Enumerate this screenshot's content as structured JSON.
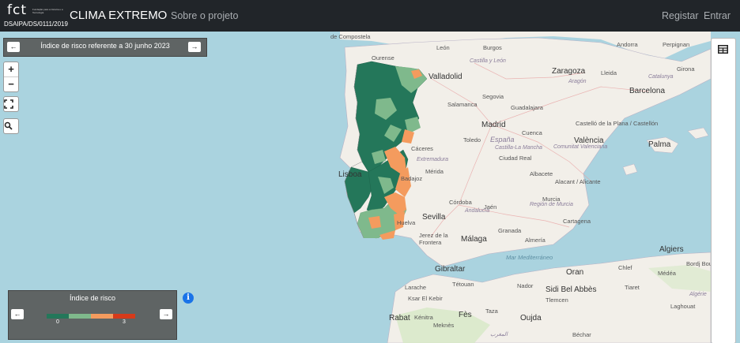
{
  "header": {
    "logo_text": "fct",
    "logo_tagline": "Fundação para a Ciência e a Tecnologia",
    "logo_code": "DSAIPA/DS/0111/2019",
    "brand": "CLIMA EXTREMO",
    "nav_about": "Sobre o projeto",
    "nav_register": "Registar",
    "nav_login": "Entrar"
  },
  "date_control": {
    "label": "Índice de risco referente a 30 junho 2023",
    "prev_icon": "←",
    "next_icon": "→"
  },
  "zoom": {
    "in": "+",
    "out": "−"
  },
  "legend": {
    "title": "Índice de risco",
    "min_label": "0",
    "max_label": "3",
    "prev_icon": "←",
    "next_icon": "→",
    "colors": [
      "#24775a",
      "#7fb98c",
      "#f49b5e",
      "#d63a1a"
    ]
  },
  "info": {
    "symbol": "i"
  },
  "map_labels": {
    "compostela": "de Compostela",
    "ourense": "Ourense",
    "leon": "León",
    "burgos": "Burgos",
    "castilla_leon": "Castilla y León",
    "valladolid": "Valladolid",
    "zaragoza": "Zaragoza",
    "aragon": "Aragón",
    "andorra": "Andorra",
    "perpignan": "Perpignan",
    "lleida": "Lleida",
    "girona": "Girona",
    "barcelona": "Barcelona",
    "catalunya": "Catalunya",
    "salamanca": "Salamanca",
    "segovia": "Segovia",
    "guadalajara": "Guadalajara",
    "madrid": "Madrid",
    "castellon": "Castelló de la Plana / Castellón",
    "toledo": "Toledo",
    "espana": "España",
    "cuenca": "Cuenca",
    "caceres": "Cáceres",
    "valencia": "València",
    "comunitat_valenciana": "Comunitat Valenciana",
    "palma": "Palma",
    "castilla_la_mancha": "Castilla-La Mancha",
    "extremadura": "Extremadura",
    "ciudad_real": "Ciudad Real",
    "merida": "Mérida",
    "albacete": "Albacete",
    "alacant": "Alacant / Alicante",
    "badajoz": "Badajoz",
    "cordoba": "Córdoba",
    "jaen": "Jaén",
    "murcia": "Murcia",
    "lisboa": "Lisboa",
    "region_murcia": "Región de Murcia",
    "sevilla": "Sevilla",
    "andalucia": "Andalucía",
    "granada": "Granada",
    "cartagena": "Cartagena",
    "huelva": "Huelva",
    "jerez": "Jerez de la Frontera",
    "malaga": "Málaga",
    "almeria": "Almería",
    "gibraltar": "Gibraltar",
    "algiers": "Algiers",
    "bordj": "Bordj Bou",
    "chlef": "Chlef",
    "medea": "Médéa",
    "oran": "Oran",
    "sidi_bel_abbes": "Sidi Bel Abbès",
    "tlemcen": "Tlemcen",
    "tiaret": "Tiaret",
    "laghouat": "Laghouat",
    "larache": "Larache",
    "ksar": "Ksar El Kebir",
    "tetouan": "Tétouan",
    "nador": "Nador",
    "taza": "Taza",
    "fes": "Fès",
    "meknes": "Meknès",
    "rabat": "Rabat",
    "kenitra": "Kénitra",
    "oujda": "Oujda",
    "bechar": "Béchar",
    "algerie": "Algérie",
    "maroc": "المغرب",
    "mer_med": "Mar Mediterráneo"
  }
}
